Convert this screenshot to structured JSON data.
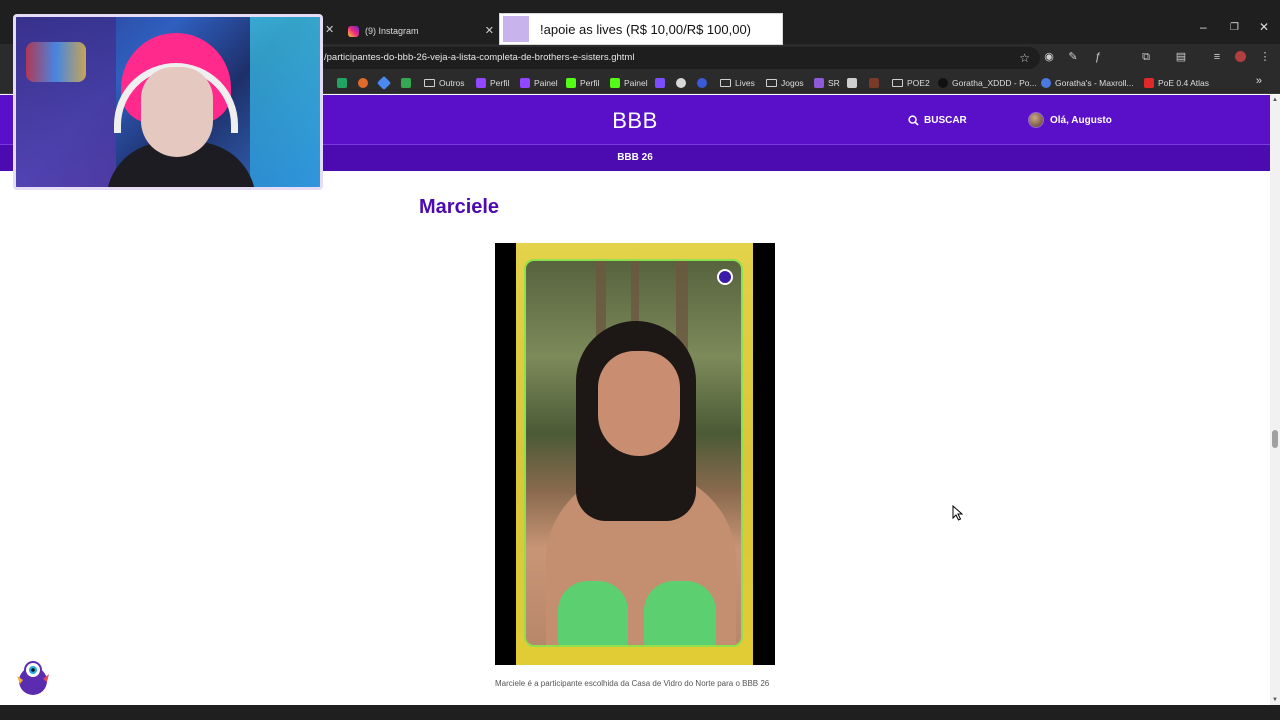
{
  "browser": {
    "tab_instagram": "(9) Instagram",
    "url": "/participantes-do-bbb-26-veja-a-lista-completa-de-brothers-e-sisters.ghtml",
    "bookmarks": [
      "Outros",
      "Perfil",
      "Painel",
      "Perfil",
      "Painel",
      "Lives",
      "Jogos",
      "SR",
      "POE2",
      "Goratha_XDDD - Po...",
      "Goratha's - Maxroll...",
      "PoE 0.4 Atlas"
    ]
  },
  "site": {
    "logo": "BBB",
    "search_label": "BUSCAR",
    "user_greeting": "Olá, Augusto",
    "subnav": "BBB 26"
  },
  "article": {
    "section_title": "Marciele",
    "caption": "Marciele é a participante escolhida da Casa de Vidro do Norte para o BBB 26"
  },
  "overlay": {
    "donation_text": "!apoie as lives (R$ 10,00/R$ 100,00)"
  },
  "colors": {
    "brand_purple": "#5a0fc8",
    "title_purple": "#4c0bb0"
  }
}
